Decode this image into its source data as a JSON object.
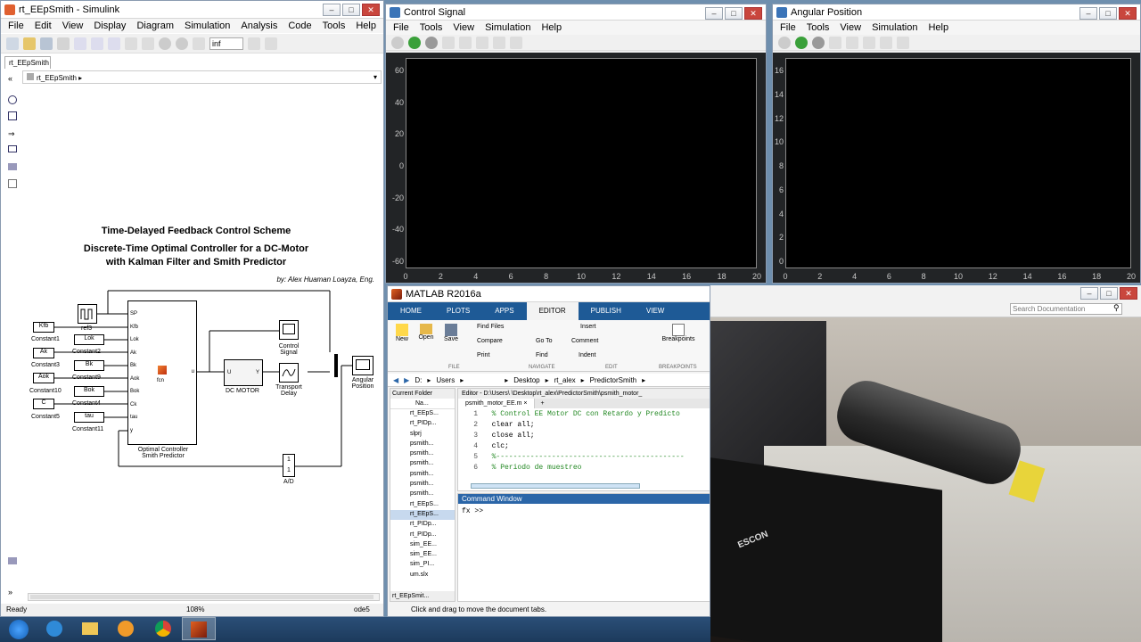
{
  "simulink": {
    "title": "rt_EEpSmith - Simulink",
    "menu": [
      "File",
      "Edit",
      "View",
      "Display",
      "Diagram",
      "Simulation",
      "Analysis",
      "Code",
      "Tools",
      "Help"
    ],
    "stop_time": "inf",
    "tab": "rt_EEpSmith",
    "breadcrumb": "rt_EEpSmith",
    "heading1": "Time-Delayed Feedback Control Scheme",
    "heading2": "Discrete-Time Optimal Controller for a DC-Motor",
    "heading3": "with Kalman Filter and Smith Predictor",
    "author": "by: Alex Huaman Loayza, Eng.",
    "blocks": {
      "kfb": "Kfb",
      "ak": "Ak",
      "aok": "Aok",
      "c": "C",
      "constant1": "Constant1",
      "constant3": "Constant3",
      "constant10": "Constant10",
      "constant5": "Constant5",
      "ref": "ref3",
      "lok": "Lok",
      "bk": "Bk",
      "bok": "Bok",
      "tau": "tau",
      "constant2": "Constant2",
      "constant9": "Constant9",
      "constant4": "Constant4",
      "constant11": "Constant11",
      "fcn": "fcn",
      "ports_in": [
        "SP",
        "Kfb",
        "Lok",
        "Ak",
        "Bk",
        "Aok",
        "Bok",
        "Ck",
        "tau",
        "y"
      ],
      "port_out": "u",
      "controller_label": "Optimal Controller Smith Predictor",
      "dc_motor": "DC MOTOR",
      "dc_u": "U",
      "dc_y": "Y",
      "control_signal": "Control Signal",
      "transport_delay": "Transport Delay",
      "angular_position": "Angular Position",
      "ad": "A/D"
    },
    "status_ready": "Ready",
    "status_zoom": "108%",
    "status_solver": "ode5"
  },
  "scope_control": {
    "title": "Control Signal",
    "menu": [
      "File",
      "Tools",
      "View",
      "Simulation",
      "Help"
    ],
    "yticks": [
      "60",
      "40",
      "20",
      "0",
      "-20",
      "-40",
      "-60"
    ],
    "xticks": [
      "0",
      "2",
      "4",
      "6",
      "8",
      "10",
      "12",
      "14",
      "16",
      "18",
      "20"
    ]
  },
  "scope_angular": {
    "title": "Angular Position",
    "menu": [
      "File",
      "Tools",
      "View",
      "Simulation",
      "Help"
    ],
    "yticks": [
      "16",
      "14",
      "12",
      "10",
      "8",
      "6",
      "4",
      "2",
      "0"
    ],
    "xticks": [
      "0",
      "2",
      "4",
      "6",
      "8",
      "10",
      "12",
      "14",
      "16",
      "18",
      "20"
    ]
  },
  "matlab": {
    "title": "MATLAB R2016a",
    "tabs": [
      "HOME",
      "PLOTS",
      "APPS",
      "EDITOR",
      "PUBLISH",
      "VIEW"
    ],
    "active_tab": "EDITOR",
    "search_placeholder": "Search Documentation",
    "ribbon": {
      "new": "New",
      "open": "Open",
      "save": "Save",
      "find_files": "Find Files",
      "compare": "Compare",
      "print": "Print",
      "goto": "Go To",
      "find": "Find",
      "insert": "Insert",
      "comment": "Comment",
      "indent": "Indent",
      "breakpoints": "Breakpoints",
      "groups": [
        "FILE",
        "NAVIGATE",
        "EDIT",
        "BREAKPOINTS"
      ]
    },
    "path": [
      "D:",
      "Users",
      "",
      "Desktop",
      "rt_alex",
      "PredictorSmith"
    ],
    "current_folder": "Current Folder",
    "name_col": "Na...",
    "files": [
      "rt_EEpS...",
      "rt_PIDp...",
      "slprj",
      "psmith...",
      "psmith...",
      "psmith...",
      "psmith...",
      "psmith...",
      "psmith...",
      "rt_EEpS...",
      "rt_EEpS...",
      "rt_PIDp...",
      "rt_PIDp...",
      "sim_EE...",
      "sim_EE...",
      "sim_PI...",
      "um.slx"
    ],
    "folder_footer": "rt_EEpSmit...",
    "editor_title": "Editor - D:\\Users\\        \\Desktop\\rt_alex\\PredictorSmith\\psmith_motor_",
    "editor_tab": "psmith_motor_EE.m",
    "code": [
      {
        "n": "1",
        "t": "  % Control EE Motor DC con Retardo y Predicto"
      },
      {
        "n": "2",
        "t": "  clear all;"
      },
      {
        "n": "3",
        "t": "  close all;"
      },
      {
        "n": "4",
        "t": "  clc;"
      },
      {
        "n": "5",
        "t": "  %--------------------------------------------"
      },
      {
        "n": "6",
        "t": "  % Periodo de muestreo"
      }
    ],
    "cmd_title": "Command Window",
    "cmd_prompt": "fx  >>",
    "status": "Click and drag to move the document tabs."
  },
  "photo": {
    "brand": "ESCON"
  },
  "colors": {
    "taskbar": "#1c3a5c",
    "matlab_tabs": "#1e5a96",
    "scope_axes": "#000000"
  }
}
